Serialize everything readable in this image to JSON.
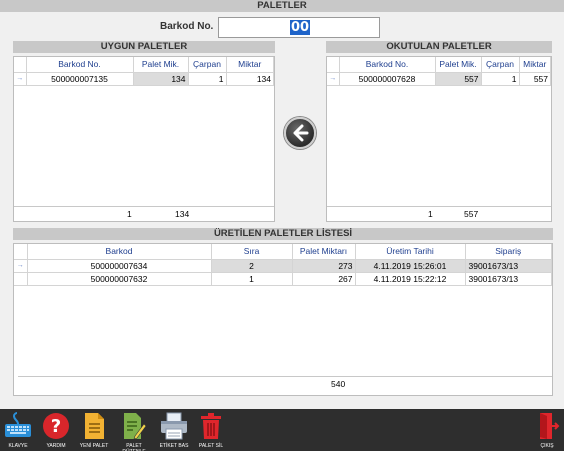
{
  "title": "PALETLER",
  "barcode": {
    "label": "Barkod No.",
    "value": "00"
  },
  "available": {
    "title": "UYGUN PALETLER",
    "columns": [
      "Barkod No.",
      "Palet Mik.",
      "Çarpan",
      "Miktar"
    ],
    "rows": [
      {
        "marker": "→",
        "barcode": "500000007135",
        "qty": "134",
        "mult": "1",
        "amount": "134"
      }
    ],
    "footer": {
      "count": "1",
      "total": "134"
    }
  },
  "scanned": {
    "title": "OKUTULAN PALETLER",
    "columns": [
      "Barkod No.",
      "Palet Mik.",
      "Çarpan",
      "Miktar"
    ],
    "rows": [
      {
        "marker": "→",
        "barcode": "500000007628",
        "qty": "557",
        "mult": "1",
        "amount": "557"
      }
    ],
    "footer": {
      "count": "1",
      "total": "557"
    }
  },
  "produced": {
    "title": "ÜRETİLEN PALETLER LİSTESİ",
    "columns": [
      "Barkod",
      "Sıra",
      "Palet Miktarı",
      "Üretim Tarihi",
      "Sipariş"
    ],
    "rows": [
      {
        "marker": "→",
        "barcode": "500000007634",
        "seq": "2",
        "qty": "273",
        "date": "4.11.2019 15:26:01",
        "order": "39001673/13"
      },
      {
        "marker": "",
        "barcode": "500000007632",
        "seq": "1",
        "qty": "267",
        "date": "4.11.2019 15:22:12",
        "order": "39001673/13"
      }
    ],
    "footer": {
      "total": "540"
    }
  },
  "toolbar": {
    "keyboard": "KLAVYE",
    "help": "YARDIM",
    "new_pallet": "YENİ PALET",
    "edit_pallet": "PALET DÜZENLE",
    "print_label": "ETİKET BAS",
    "delete_pallet": "PALET SİL",
    "exit": "ÇIKIŞ"
  },
  "colors": {
    "toolbar_bg": "#2e2e2e",
    "help_red": "#d9262b",
    "doc_yellow": "#f2b233",
    "edit_green": "#7fb04a",
    "delete_red": "#e0262c",
    "keyboard_blue": "#2a8fd8"
  }
}
